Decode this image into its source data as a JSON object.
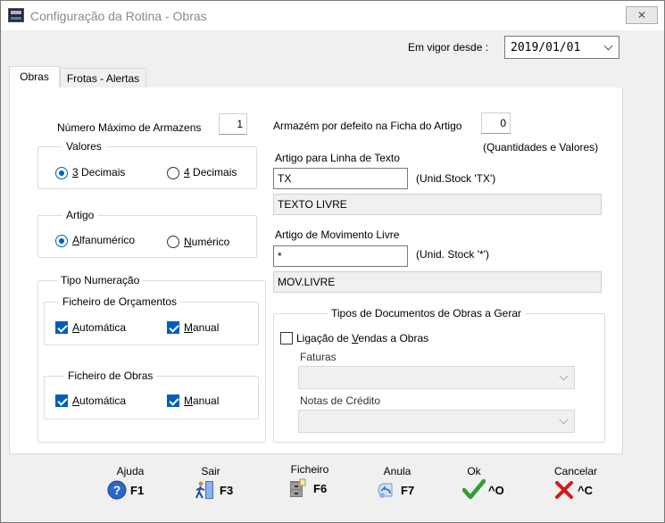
{
  "window": {
    "title": "Configuração da Rotina - Obras",
    "close_label": "✕"
  },
  "header": {
    "vigor_label": "Em vigor desde :",
    "vigor_value": "2019/01/01"
  },
  "tabs": [
    {
      "label": "Obras"
    },
    {
      "label": "Frotas - Alertas"
    }
  ],
  "obras": {
    "max_armazens_label": "Número Máximo de Armazens",
    "max_armazens_value": "1",
    "valores": {
      "title": "Valores",
      "opt1": "3 Decimais",
      "opt2": "4 Decimais",
      "opt1_key": "3",
      "opt1_rest": " Decimais",
      "opt2_key": "4",
      "opt2_rest": " Decimais"
    },
    "artigo": {
      "title": "Artigo",
      "opt1_key": "A",
      "opt1_rest": "lfanumérico",
      "opt2_key": "N",
      "opt2_rest": "umérico"
    },
    "tipo_numeracao": {
      "title": "Tipo Numeração",
      "orcamentos": {
        "title": "Ficheiro de Orçamentos",
        "auto_key": "A",
        "auto_rest": "utomática",
        "manual_key": "M",
        "manual_rest": "anual"
      },
      "obras": {
        "title": "Ficheiro de Obras",
        "auto_key": "A",
        "auto_rest": "utomática",
        "manual_key": "M",
        "manual_rest": "anual"
      }
    },
    "armazem_label": "Armazém por defeito na Ficha do Artigo",
    "armazem_value": "0",
    "armazem_note": "(Quantidades e Valores)",
    "artigo_texto_label": "Artigo para Linha de Texto",
    "artigo_texto_value": "TX",
    "artigo_texto_note": "(Unid.Stock 'TX')",
    "artigo_texto_desc": "TEXTO LIVRE",
    "artigo_mov_label": "Artigo de Movimento Livre",
    "artigo_mov_value": "*",
    "artigo_mov_note": "(Unid. Stock '*')",
    "artigo_mov_desc": "MOV.LIVRE",
    "tipos_docs": {
      "title": "Tipos de Documentos de Obras a Gerar",
      "ligacao_pre": "Ligação de ",
      "ligacao_key": "V",
      "ligacao_post": "endas a Obras",
      "faturas_label": "Faturas",
      "notas_label": "Notas de Crédito"
    }
  },
  "buttons": [
    {
      "caption": "Ajuda",
      "key": "F1",
      "icon": "help-icon"
    },
    {
      "caption": "Sair",
      "key": "F3",
      "icon": "exit-person-icon"
    },
    {
      "caption": "Ficheiro",
      "key": "F6",
      "icon": "file-cabinet-icon"
    },
    {
      "caption": "Anula",
      "key": "F7",
      "icon": "undo-icon"
    },
    {
      "caption": "Ok",
      "key": "^O",
      "icon": "checkmark-icon"
    },
    {
      "caption": "Cancelar",
      "key": "^C",
      "icon": "cross-icon"
    }
  ],
  "colors": {
    "accent": "#005fb8",
    "ok_green": "#2e9e2e",
    "cancel_red": "#d11a1a",
    "help_blue": "#2a68c8"
  }
}
